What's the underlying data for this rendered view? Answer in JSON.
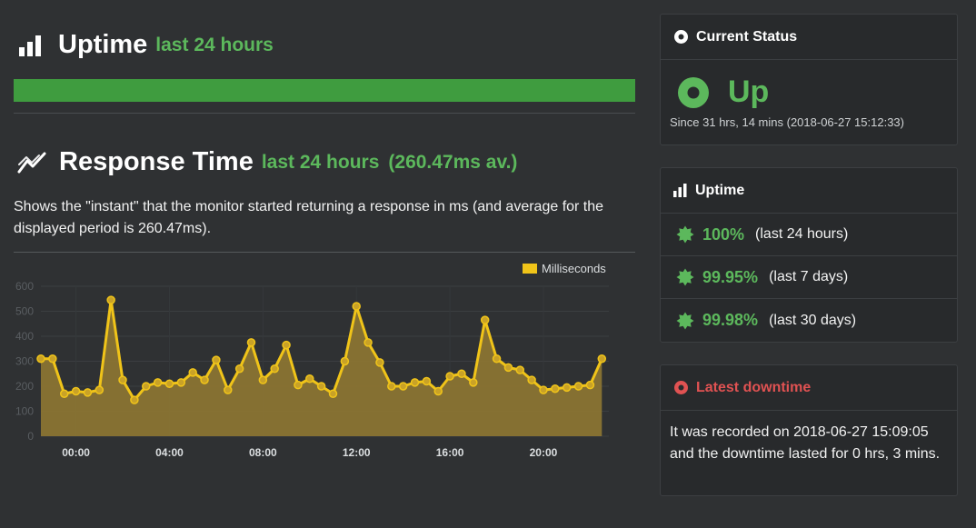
{
  "uptime_section": {
    "title": "Uptime",
    "subtitle": "last 24 hours",
    "bar_percent": 100,
    "bar_color": "#3f9c3f"
  },
  "response_section": {
    "title": "Response Time",
    "subtitle": "last 24 hours",
    "average": "(260.47ms av.)",
    "description": "Shows the \"instant\" that the monitor started returning a response in ms (and average for the displayed period is 260.47ms)."
  },
  "chart_data": {
    "type": "area",
    "legend": "Milliseconds",
    "legend_position": "top-right",
    "series_color": "#f0c419",
    "y_ticks": [
      "0",
      "100",
      "200",
      "300",
      "400",
      "500",
      "600"
    ],
    "ylim": [
      0,
      600
    ],
    "x_ticks": [
      "00:00",
      "04:00",
      "08:00",
      "12:00",
      "16:00",
      "20:00"
    ],
    "x_tick_hours": [
      0,
      4,
      8,
      12,
      16,
      20
    ],
    "xlim": [
      -1.5,
      22.8
    ],
    "grid": true,
    "x": [
      -1.5,
      -1.0,
      -0.5,
      0.0,
      0.5,
      1.0,
      1.5,
      2.0,
      2.5,
      3.0,
      3.5,
      4.0,
      4.5,
      5.0,
      5.5,
      6.0,
      6.5,
      7.0,
      7.5,
      8.0,
      8.5,
      9.0,
      9.5,
      10.0,
      10.5,
      11.0,
      11.5,
      12.0,
      12.5,
      13.0,
      13.5,
      14.0,
      14.5,
      15.0,
      15.5,
      16.0,
      16.5,
      17.0,
      17.5,
      18.0,
      18.5,
      19.0,
      19.5,
      20.0,
      20.5,
      21.0,
      21.5,
      22.0,
      22.5
    ],
    "values": [
      310,
      310,
      170,
      180,
      175,
      185,
      545,
      225,
      145,
      200,
      215,
      210,
      215,
      255,
      225,
      305,
      185,
      270,
      375,
      225,
      270,
      365,
      205,
      230,
      200,
      170,
      300,
      520,
      375,
      295,
      200,
      200,
      215,
      220,
      180,
      240,
      250,
      215,
      465,
      310,
      275,
      265,
      225,
      185,
      190,
      195,
      200,
      205,
      310
    ]
  },
  "current_status": {
    "title": "Current Status",
    "status": "Up",
    "since": "Since 31 hrs, 14 mins (2018-06-27 15:12:33)"
  },
  "uptime_panel": {
    "title": "Uptime",
    "rows": [
      {
        "value": "100%",
        "period": "(last 24 hours)"
      },
      {
        "value": "99.95%",
        "period": "(last 7 days)"
      },
      {
        "value": "99.98%",
        "period": "(last 30 days)"
      }
    ]
  },
  "latest_downtime": {
    "title": "Latest downtime",
    "text": "It was recorded on 2018-06-27 15:09:05 and the downtime lasted for 0 hrs, 3 mins."
  }
}
